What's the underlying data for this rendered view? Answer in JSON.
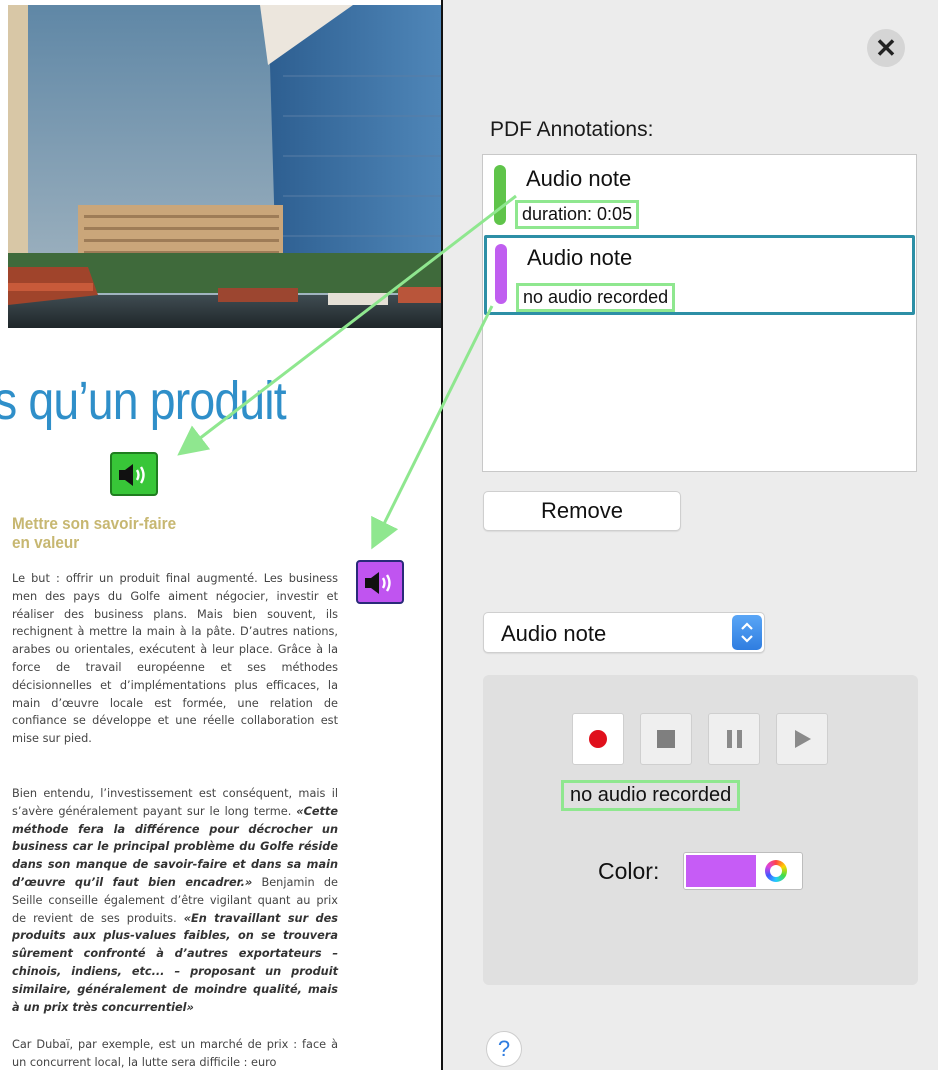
{
  "panel": {
    "title": "PDF Annotations:",
    "annotations": [
      {
        "name": "Audio note",
        "detail": "duration:  0:05",
        "color": "#5fc44a"
      },
      {
        "name": "Audio note",
        "detail": "no audio recorded",
        "color": "#c05ef0",
        "selected": true
      }
    ],
    "remove_label": "Remove",
    "type_select": "Audio note",
    "recorder": {
      "status": "no audio recorded",
      "color_label": "Color:",
      "color_value": "#c65cf6"
    },
    "help_label": "?",
    "close_label": "✕"
  },
  "pdf": {
    "headline": "s qu’un produit",
    "subhead_line1": "Mettre son savoir-faire",
    "subhead_line2": "en valeur",
    "para1": "Le but : offrir un produit final augmenté. Les business men des pays du Golfe aiment négocier, investir et réaliser des business plans. Mais bien souvent, ils rechignent à mettre la main à la pâte. D’autres nations, arabes ou orientales, exécutent à leur place. Grâce à la force de travail européenne et ses méthodes décisionnelles et d’implémentations plus efficaces, la main d’œuvre locale est formée, une relation de confiance se développe et une réelle collaboration est mise sur pied.",
    "para2_a": "Bien entendu, l’investissement est conséquent, mais il s’avère généralement payant sur le long terme. ",
    "para2_quote1": "«Cette méthode fera la différence pour décrocher un business car le principal problème du Golfe réside dans son manque de savoir-faire et dans sa main d’œuvre qu’il faut bien encadrer.»",
    "para2_b": " Benjamin de Seille conseille également d’être vigilant quant au prix de revient de ses produits. ",
    "para2_quote2": "«En travaillant sur des produits aux plus-values faibles, on se trouvera sûrement confronté à d’autres exportateurs – chinois, indiens, etc... – proposant un produit similaire, généralement de moindre qualité, mais à un prix très concurrentiel»",
    "para3": "Car Dubaï, par exemple, est un marché de prix : face à un concurrent local, la lutte sera difficile : euro"
  },
  "icons": {
    "speaker_green": "speaker-icon",
    "speaker_purple": "speaker-icon",
    "record": "record-icon",
    "stop": "stop-icon",
    "pause": "pause-icon",
    "play": "play-icon",
    "color_wheel": "color-wheel-icon",
    "stepper": "up-down-chevron-icon"
  }
}
